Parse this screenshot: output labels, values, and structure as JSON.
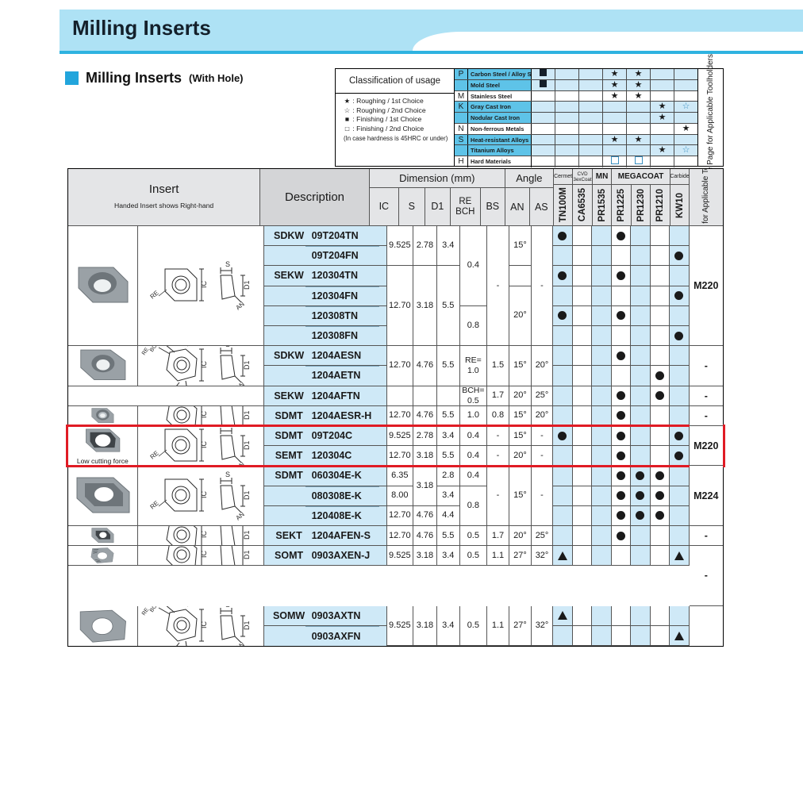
{
  "header": {
    "title": "Milling Inserts"
  },
  "section": {
    "title": "Milling Inserts",
    "subtitle": "(With Hole)"
  },
  "classification": {
    "title": "Classification of usage",
    "legend": [
      {
        "symbol": "★",
        "text": ": Roughing / 1st Choice"
      },
      {
        "symbol": "☆",
        "text": ": Roughing / 2nd Choice"
      },
      {
        "symbol": "■",
        "text": ": Finishing / 1st Choice"
      },
      {
        "symbol": "□",
        "text": ": Finishing / 2nd Choice"
      }
    ],
    "note": "(In case hardness is 45HRC or under)",
    "rows": [
      {
        "iso": "P",
        "material": "Carbon Steel / Alloy Steel",
        "shade": "blue",
        "marks": [
          "sq-f",
          "",
          "",
          "star-f",
          "star-f",
          "",
          ""
        ]
      },
      {
        "iso": "",
        "material": "Mold Steel",
        "shade": "blue",
        "marks": [
          "sq-f",
          "",
          "",
          "star-f",
          "star-f",
          "",
          ""
        ]
      },
      {
        "iso": "M",
        "material": "Stainless Steel",
        "shade": "white",
        "marks": [
          "",
          "",
          "",
          "star-f",
          "star-f",
          "",
          ""
        ]
      },
      {
        "iso": "K",
        "material": "Gray Cast Iron",
        "shade": "blue",
        "marks": [
          "",
          "",
          "",
          "",
          "",
          "star-f",
          "star-o"
        ]
      },
      {
        "iso": "",
        "material": "Nodular Cast Iron",
        "shade": "blue",
        "marks": [
          "",
          "",
          "",
          "",
          "",
          "star-f",
          ""
        ]
      },
      {
        "iso": "N",
        "material": "Non-ferrous Metals",
        "shade": "white",
        "marks": [
          "",
          "",
          "",
          "",
          "",
          "",
          "star-f"
        ]
      },
      {
        "iso": "S",
        "material": "Heat-resistant Alloys",
        "shade": "blue",
        "marks": [
          "",
          "",
          "",
          "star-f",
          "star-f",
          "",
          ""
        ]
      },
      {
        "iso": "",
        "material": "Titanium Alloys",
        "shade": "blue",
        "marks": [
          "",
          "",
          "",
          "",
          "",
          "star-f",
          "star-o"
        ]
      },
      {
        "iso": "H",
        "material": "Hard Materials",
        "shade": "white",
        "marks": [
          "",
          "",
          "",
          "sq-o",
          "sq-o",
          "",
          ""
        ]
      }
    ],
    "seepage": "See Page for Applicable Toolholders"
  },
  "table": {
    "headers": {
      "insert": "Insert",
      "insert_note": "Handed Insert shows Right-hand",
      "description": "Description",
      "dimension": "Dimension (mm)",
      "angle": "Angle",
      "dim_cols": [
        "IC",
        "S",
        "D1",
        "RE\nBCH",
        "BS"
      ],
      "angle_cols": [
        "AN",
        "AS"
      ],
      "grade_groups": [
        {
          "label": "Cermet",
          "span": 1,
          "small": true
        },
        {
          "label": "CVD 3exCoat",
          "span": 1,
          "small": true
        },
        {
          "label": "MN",
          "span": 1,
          "small": false
        },
        {
          "label": "MEGACOAT",
          "span": 3,
          "small": false
        },
        {
          "label": "Carbide",
          "span": 1,
          "small": true
        }
      ],
      "grades": [
        "TN100M",
        "CA6535",
        "PR1535",
        "PR1225",
        "PR1230",
        "PR1210",
        "KW10"
      ],
      "toolholder": "See Page for Applicable Toolholders"
    },
    "groups": [
      {
        "id": "g1",
        "drawing": "type-a",
        "photo": "insert-square-hole",
        "caption": "",
        "toolholder": "M220",
        "rows": [
          {
            "prefix": "SDKW",
            "code": "09T204TN",
            "sep": false,
            "ic": "9.525",
            "s": "2.78",
            "d1": "3.4",
            "re": "",
            "bs": "",
            "an": "15°",
            "as": "",
            "marks": [
              "dot",
              "",
              "",
              "dot",
              "",
              "",
              ""
            ]
          },
          {
            "prefix": "",
            "code": "09T204FN",
            "sep": true,
            "ic": "",
            "s": "",
            "d1": "",
            "re": "",
            "bs": "",
            "an": "",
            "as": "",
            "marks": [
              "",
              "",
              "",
              "",
              "",
              "",
              "dot"
            ]
          },
          {
            "prefix": "SEKW",
            "code": "120304TN",
            "sep": false,
            "ic": "",
            "s": "",
            "d1": "",
            "re": "",
            "bs": "",
            "an": "",
            "as": "",
            "marks": [
              "dot",
              "",
              "",
              "dot",
              "",
              "",
              ""
            ]
          },
          {
            "prefix": "",
            "code": "120304FN",
            "sep": true,
            "ic": "",
            "s": "",
            "d1": "",
            "re": "",
            "bs": "",
            "an": "",
            "as": "",
            "marks": [
              "",
              "",
              "",
              "",
              "",
              "",
              "dot"
            ]
          },
          {
            "prefix": "",
            "code": "120308TN",
            "sep": true,
            "ic": "",
            "s": "",
            "d1": "",
            "re": "",
            "bs": "",
            "an": "",
            "as": "",
            "marks": [
              "dot",
              "",
              "",
              "dot",
              "",
              "",
              ""
            ]
          },
          {
            "prefix": "",
            "code": "120308FN",
            "sep": true,
            "ic": "",
            "s": "",
            "d1": "",
            "re": "",
            "bs": "",
            "an": "",
            "as": "",
            "marks": [
              "",
              "",
              "",
              "",
              "",
              "",
              "dot"
            ]
          }
        ],
        "spans": {
          "ic": [
            {
              "text": "9.525",
              "rows": 2
            },
            {
              "text": "12.70",
              "rows": 4
            }
          ],
          "s": [
            {
              "text": "2.78",
              "rows": 2
            },
            {
              "text": "3.18",
              "rows": 4
            }
          ],
          "d1": [
            {
              "text": "3.4",
              "rows": 2
            },
            {
              "text": "5.5",
              "rows": 4
            }
          ],
          "re": [
            {
              "text": "0.4",
              "rows": 4
            },
            {
              "text": "0.8",
              "rows": 2
            }
          ],
          "bs": [
            {
              "text": "-",
              "rows": 6
            }
          ],
          "an": [
            {
              "text": "15°",
              "rows": 2
            },
            {
              "text": "",
              "rows": 1
            },
            {
              "text": "20°",
              "rows": 3
            }
          ],
          "as": [
            {
              "text": "-",
              "rows": 6
            }
          ]
        }
      },
      {
        "id": "g2",
        "drawing": "type-b",
        "photo": "insert-chamfer-hole",
        "caption": "",
        "toolholder": "-",
        "rows": [
          {
            "prefix": "SDKW",
            "code": "1204AESN",
            "sep": false,
            "marks": [
              "",
              "",
              "",
              "dot",
              "",
              "",
              ""
            ]
          },
          {
            "prefix": "",
            "code": "1204AETN",
            "sep": true,
            "marks": [
              "",
              "",
              "",
              "",
              "",
              "dot",
              ""
            ]
          }
        ],
        "spans": {
          "ic": [
            {
              "text": "12.70",
              "rows": 2
            }
          ],
          "s": [
            {
              "text": "4.76",
              "rows": 2
            }
          ],
          "d1": [
            {
              "text": "5.5",
              "rows": 2
            }
          ],
          "re": [
            {
              "text": "RE=\n1.0",
              "rows": 2
            }
          ],
          "bs": [
            {
              "text": "1.5",
              "rows": 2
            }
          ],
          "an": [
            {
              "text": "15°",
              "rows": 2
            }
          ],
          "as": [
            {
              "text": "20°",
              "rows": 2
            }
          ]
        }
      },
      {
        "id": "g3",
        "drawing": "",
        "photo": "",
        "caption": "",
        "toolholder": "-",
        "rows": [
          {
            "prefix": "SEKW",
            "code": "1204AFTN",
            "sep": false,
            "marks": [
              "",
              "",
              "",
              "dot",
              "",
              "dot",
              ""
            ]
          }
        ],
        "spans": {
          "ic": [
            {
              "text": "",
              "rows": 1
            }
          ],
          "s": [
            {
              "text": "",
              "rows": 1
            }
          ],
          "d1": [
            {
              "text": "",
              "rows": 1
            }
          ],
          "re": [
            {
              "text": "BCH=\n0.5",
              "rows": 1
            }
          ],
          "bs": [
            {
              "text": "1.7",
              "rows": 1
            }
          ],
          "an": [
            {
              "text": "20°",
              "rows": 1
            }
          ],
          "as": [
            {
              "text": "25°",
              "rows": 1
            }
          ]
        }
      },
      {
        "id": "g4",
        "drawing": "type-c",
        "photo": "insert-round-hole",
        "caption": "",
        "toolholder": "-",
        "rows": [
          {
            "prefix": "SDMT",
            "code": "1204AESR-H",
            "sep": false,
            "marks": [
              "",
              "",
              "",
              "dot",
              "",
              "",
              ""
            ]
          }
        ],
        "spans": {
          "ic": [
            {
              "text": "12.70",
              "rows": 1
            }
          ],
          "s": [
            {
              "text": "4.76",
              "rows": 1
            }
          ],
          "d1": [
            {
              "text": "5.5",
              "rows": 1
            }
          ],
          "re": [
            {
              "text": "1.0",
              "rows": 1
            }
          ],
          "bs": [
            {
              "text": "0.8",
              "rows": 1
            }
          ],
          "an": [
            {
              "text": "15°",
              "rows": 1
            }
          ],
          "as": [
            {
              "text": "20°",
              "rows": 1
            }
          ]
        }
      },
      {
        "id": "g5",
        "drawing": "type-a",
        "photo": "insert-lowforce",
        "caption": "Low cutting force",
        "toolholder": "M220",
        "highlight": true,
        "rows": [
          {
            "prefix": "SDMT",
            "code": "09T204C",
            "sep": false,
            "ic": "9.525",
            "s": "2.78",
            "d1": "3.4",
            "re": "0.4",
            "bs": "-",
            "an": "15°",
            "as": "-",
            "marks": [
              "dot",
              "",
              "",
              "dot",
              "",
              "",
              "dot"
            ]
          },
          {
            "prefix": "SEMT",
            "code": "120304C",
            "sep": false,
            "ic": "12.70",
            "s": "3.18",
            "d1": "5.5",
            "re": "0.4",
            "bs": "-",
            "an": "20°",
            "as": "-",
            "marks": [
              "",
              "",
              "",
              "dot",
              "",
              "",
              "dot"
            ]
          }
        ],
        "percell": true
      },
      {
        "id": "g6",
        "drawing": "type-d",
        "photo": "insert-ek",
        "caption": "",
        "toolholder": "M224",
        "rows": [
          {
            "prefix": "SDMT",
            "code": "060304E-K",
            "sep": false,
            "marks": [
              "",
              "",
              "",
              "dot",
              "dot",
              "dot",
              ""
            ]
          },
          {
            "prefix": "",
            "code": "080308E-K",
            "sep": true,
            "marks": [
              "",
              "",
              "",
              "dot",
              "dot",
              "dot",
              ""
            ]
          },
          {
            "prefix": "",
            "code": "120408E-K",
            "sep": true,
            "marks": [
              "",
              "",
              "",
              "dot",
              "dot",
              "dot",
              ""
            ]
          }
        ],
        "spans": {
          "ic": [
            {
              "text": "6.35",
              "rows": 1
            },
            {
              "text": "8.00",
              "rows": 1
            },
            {
              "text": "12.70",
              "rows": 1
            }
          ],
          "s": [
            {
              "text": "3.18",
              "rows": 2
            },
            {
              "text": "4.76",
              "rows": 1
            }
          ],
          "d1": [
            {
              "text": "2.8",
              "rows": 1
            },
            {
              "text": "3.4",
              "rows": 1
            },
            {
              "text": "4.4",
              "rows": 1
            }
          ],
          "re": [
            {
              "text": "0.4",
              "rows": 1
            },
            {
              "text": "0.8",
              "rows": 2
            }
          ],
          "bs": [
            {
              "text": "-",
              "rows": 3
            }
          ],
          "an": [
            {
              "text": "15°",
              "rows": 3
            }
          ],
          "as": [
            {
              "text": "-",
              "rows": 3
            }
          ]
        }
      },
      {
        "id": "g7",
        "drawing": "type-b",
        "photo": "insert-sekt",
        "caption": "",
        "toolholder": "-",
        "rows": [
          {
            "prefix": "SEKT",
            "code": "1204AFEN-S",
            "sep": false,
            "marks": [
              "",
              "",
              "",
              "dot",
              "",
              "",
              ""
            ]
          }
        ],
        "spans": {
          "ic": [
            {
              "text": "12.70",
              "rows": 1
            }
          ],
          "s": [
            {
              "text": "4.76",
              "rows": 1
            }
          ],
          "d1": [
            {
              "text": "5.5",
              "rows": 1
            }
          ],
          "re": [
            {
              "text": "0.5",
              "rows": 1
            }
          ],
          "bs": [
            {
              "text": "1.7",
              "rows": 1
            }
          ],
          "an": [
            {
              "text": "20°",
              "rows": 1
            }
          ],
          "as": [
            {
              "text": "25°",
              "rows": 1
            }
          ]
        }
      },
      {
        "id": "g8",
        "drawing": "type-e",
        "photo": "insert-somt",
        "caption": "",
        "toolholder": "-",
        "toolholder_span": 2,
        "rows": [
          {
            "prefix": "SOMT",
            "code": "0903AXEN-J",
            "sep": false,
            "marks": [
              "tri",
              "",
              "",
              "",
              "",
              "",
              "tri"
            ]
          }
        ],
        "spans": {
          "ic": [
            {
              "text": "9.525",
              "rows": 1
            }
          ],
          "s": [
            {
              "text": "3.18",
              "rows": 1
            }
          ],
          "d1": [
            {
              "text": "3.4",
              "rows": 1
            }
          ],
          "re": [
            {
              "text": "0.5",
              "rows": 1
            }
          ],
          "bs": [
            {
              "text": "1.1",
              "rows": 1
            }
          ],
          "an": [
            {
              "text": "27°",
              "rows": 1
            }
          ],
          "as": [
            {
              "text": "32°",
              "rows": 1
            }
          ]
        }
      },
      {
        "id": "g9",
        "drawing": "type-f",
        "photo": "insert-somw",
        "caption": "",
        "toolholder": "",
        "rows": [
          {
            "prefix": "SOMW",
            "code": "0903AXTN",
            "sep": false,
            "marks": [
              "tri",
              "",
              "",
              "",
              "",
              "",
              ""
            ]
          },
          {
            "prefix": "",
            "code": "0903AXFN",
            "sep": true,
            "marks": [
              "",
              "",
              "",
              "",
              "",
              "",
              "tri"
            ]
          }
        ],
        "spans": {
          "ic": [
            {
              "text": "9.525",
              "rows": 2
            }
          ],
          "s": [
            {
              "text": "3.18",
              "rows": 2
            }
          ],
          "d1": [
            {
              "text": "3.4",
              "rows": 2
            }
          ],
          "re": [
            {
              "text": "0.5",
              "rows": 2
            }
          ],
          "bs": [
            {
              "text": "1.1",
              "rows": 2
            }
          ],
          "an": [
            {
              "text": "27°",
              "rows": 2
            }
          ],
          "as": [
            {
              "text": "32°",
              "rows": 2
            }
          ]
        }
      }
    ]
  },
  "colors": {
    "header_band": "#aee2f5",
    "accent": "#22a5dc",
    "row_blue": "#cfe9f7",
    "class_blue": "#5ec3e8",
    "highlight": "#e01b24"
  }
}
